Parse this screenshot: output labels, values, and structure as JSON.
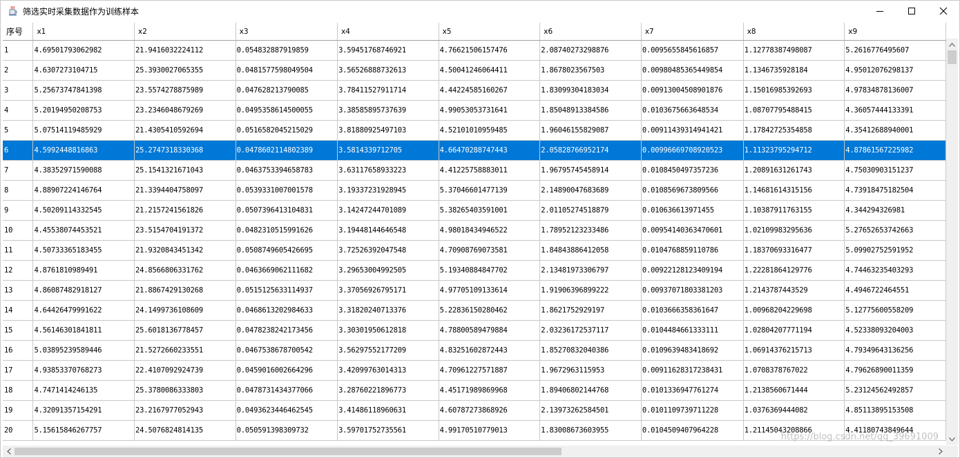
{
  "window": {
    "title": "筛选实时采集数据作为训练样本",
    "watermark": "https://blog.csdn.net/qq_39691009"
  },
  "colors": {
    "selection": "#0078d7",
    "grid": "#c8c8c8"
  },
  "icons": {
    "app": "java-cup-icon",
    "minimize": "minimize-icon",
    "maximize": "maximize-icon",
    "close": "close-icon"
  },
  "table": {
    "selected_row": 6,
    "columns": [
      "序号",
      "x1",
      "x2",
      "x3",
      "x4",
      "x5",
      "x6",
      "x7",
      "x8",
      "x9"
    ],
    "rows": [
      [
        "1",
        "4.69501793062982",
        "21.9416032224112",
        "0.054832887919859",
        "3.59451768746921",
        "4.76621506157476",
        "2.08740273298876",
        "0.0095655845616857",
        "1.12778387498087",
        "5.2616776495607"
      ],
      [
        "2",
        "4.6307273104715",
        "25.3930027065355",
        "0.0481577598049504",
        "3.56526888732613",
        "4.50041246064411",
        "1.8678023567503",
        "0.00980485365449854",
        "1.1346735928184",
        "4.95012076298137"
      ],
      [
        "3",
        "5.25673747841398",
        "23.5574278875989",
        "0.047628213790085",
        "3.78411527911714",
        "4.44224585160267",
        "1.83099304183034",
        "0.00913004508901876",
        "1.15016985392693",
        "4.97834878136007"
      ],
      [
        "4",
        "5.20194950208753",
        "23.2346048679269",
        "0.0495358614500055",
        "3.38585895737639",
        "4.99053053731641",
        "1.85048913384586",
        "0.0103675663648534",
        "1.08707795488415",
        "4.36057444133391"
      ],
      [
        "5",
        "5.07514119485929",
        "21.4305410592694",
        "0.0516582045215029",
        "3.81880925497103",
        "4.52101010959485",
        "1.96046155829087",
        "0.00911439314941421",
        "1.17842725354858",
        "4.35412688940001"
      ],
      [
        "6",
        "4.5992448816863",
        "25.2747318330368",
        "0.0478602114802389",
        "3.5814339712705",
        "4.66470288747443",
        "2.05828766952174",
        "0.00996669708920523",
        "1.11323795294712",
        "4.87861567225982"
      ],
      [
        "7",
        "4.38352971590088",
        "25.1541321671043",
        "0.0463753394658783",
        "3.63117658933223",
        "4.41225758883011",
        "1.96795745458914",
        "0.0108450497357236",
        "1.20891631261743",
        "4.75030903151237"
      ],
      [
        "8",
        "4.88907224146764",
        "21.3394404758097",
        "0.0539331007001578",
        "3.19337231928945",
        "5.37046601477139",
        "2.14890047683689",
        "0.0108569673809566",
        "1.14681614315156",
        "4.73918475182504"
      ],
      [
        "9",
        "4.50209114332545",
        "21.2157241561826",
        "0.0507396413104831",
        "3.14247244701089",
        "5.38265403591001",
        "2.01105274518879",
        "0.010636613971455",
        "1.10387911763155",
        "4.344294326981"
      ],
      [
        "10",
        "4.45538074453521",
        "23.5154704191372",
        "0.0482310515991626",
        "3.19448144646548",
        "4.98018434946522",
        "1.78952123233486",
        "0.00954140363470601",
        "1.02109983295636",
        "5.27652653742663"
      ],
      [
        "11",
        "4.50733365183455",
        "21.9320843451342",
        "0.0508749605426695",
        "3.72526392047548",
        "4.70908769073581",
        "1.84843886412058",
        "0.0104768859110786",
        "1.18370693316477",
        "5.09902752591952"
      ],
      [
        "12",
        "4.8761810989491",
        "24.8566806331762",
        "0.0463669062111682",
        "3.29653004992505",
        "5.19340884847702",
        "2.13481973306797",
        "0.00922128123409194",
        "1.22281864129776",
        "4.74463235403293"
      ],
      [
        "13",
        "4.86087482918127",
        "21.8867429130268",
        "0.0515125633114937",
        "3.37056926795171",
        "4.97705109133614",
        "1.91906396899222",
        "0.00937071803381203",
        "1.2143787443529",
        "4.4946722464551"
      ],
      [
        "14",
        "4.64426479991622",
        "24.1499736108609",
        "0.0468613202984633",
        "3.31820240713376",
        "5.22836150280462",
        "1.8621752929197",
        "0.0103666358361647",
        "1.00968204229698",
        "5.12775600558209"
      ],
      [
        "15",
        "4.56146301841811",
        "25.6018136778457",
        "0.0478238242173456",
        "3.30301950612818",
        "4.78800589479884",
        "2.03236172537117",
        "0.0104484661333111",
        "1.02804207771194",
        "4.52338093204003"
      ],
      [
        "16",
        "5.03895239589446",
        "21.5272660233551",
        "0.0467538678700542",
        "3.56297552177209",
        "4.83251602872443",
        "1.85270832040386",
        "0.0109639483418692",
        "1.06914376215713",
        "4.79349643136256"
      ],
      [
        "17",
        "4.93853370768273",
        "22.4107092924739",
        "0.0459016002664296",
        "3.42099763014313",
        "4.70961227571887",
        "1.9672963115953",
        "0.00911628317238431",
        "1.0708378767022",
        "4.79626890011359"
      ],
      [
        "18",
        "4.7471414246135",
        "25.3780086333803",
        "0.0478731434377066",
        "3.28760221896773",
        "4.45171989869968",
        "1.89406802144768",
        "0.0101336947761274",
        "1.2138560671444",
        "5.23124562492857"
      ],
      [
        "19",
        "4.32091357154291",
        "23.2167977052943",
        "0.0493623446462545",
        "3.41486118960631",
        "4.60787273868926",
        "2.13973262584501",
        "0.0101109739711228",
        "1.0376369444082",
        "4.85113895153508"
      ],
      [
        "20",
        "5.15615846267757",
        "24.5076824814135",
        "0.050591398309732",
        "3.59701752735561",
        "4.99170510779013",
        "1.83008673603955",
        "0.0104509407964228",
        "1.21145043208866",
        "4.41180743849644"
      ]
    ]
  }
}
